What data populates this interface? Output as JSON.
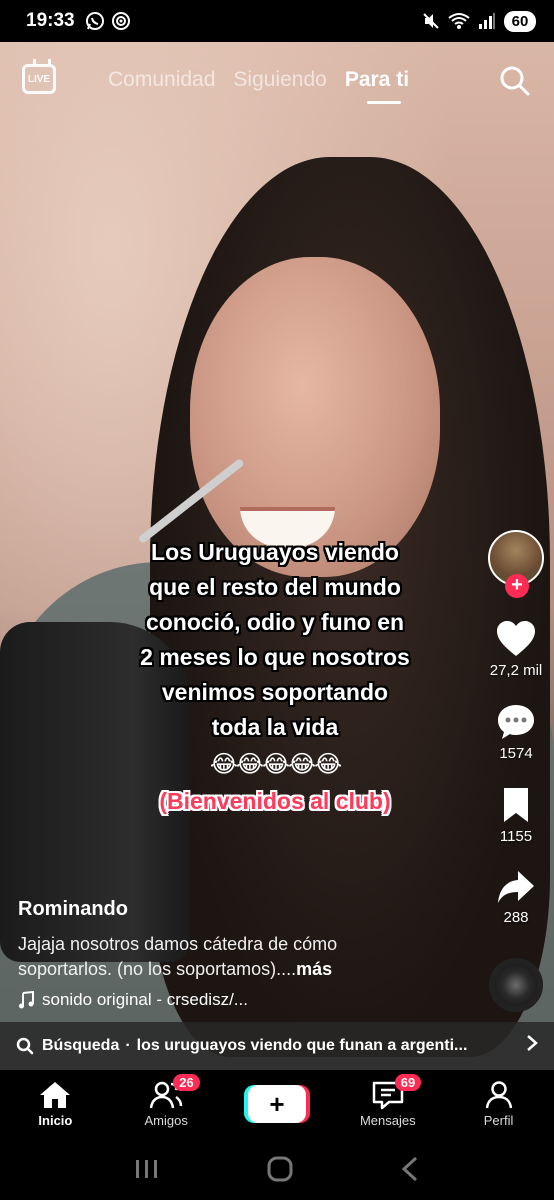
{
  "status_bar": {
    "time": "19:33",
    "left_icons": [
      "whatsapp-icon",
      "hotspot-icon"
    ],
    "right_icons": [
      "mute-icon",
      "wifi-icon",
      "signal-icon"
    ],
    "battery": "60"
  },
  "top_nav": {
    "live_label": "LIVE",
    "tabs": [
      {
        "label": "Comunidad",
        "active": false
      },
      {
        "label": "Siguiendo",
        "active": false
      },
      {
        "label": "Para ti",
        "active": true
      }
    ]
  },
  "overlay": {
    "lines": [
      "Los Uruguayos viendo",
      "que el resto del mundo",
      "conoció, odio y funo en",
      "2 meses lo que nosotros",
      "venimos soportando",
      "toda la vida"
    ],
    "emoji": "😂😂😂😂😂",
    "subtitle": "(Bienvenidos al club)"
  },
  "rail": {
    "likes": "27,2 mil",
    "comments": "1574",
    "saves": "1155",
    "shares": "288"
  },
  "post": {
    "author": "Rominando",
    "description": "Jajaja nosotros damos cátedra de cómo soportarlos. (no los soportamos)....",
    "more": "más",
    "sound": "sonido original - crsedisz/..."
  },
  "search_suggestion": {
    "label": "Búsqueda",
    "separator": "·",
    "query": "los uruguayos viendo que funan a argenti..."
  },
  "bottom_nav": {
    "items": [
      {
        "label": "Inicio",
        "active": true
      },
      {
        "label": "Amigos",
        "badge": "26"
      },
      {
        "label": "",
        "create": true
      },
      {
        "label": "Mensajes",
        "badge": "69"
      },
      {
        "label": "Perfil"
      }
    ]
  },
  "colors": {
    "accent": "#fe2c55",
    "cyan": "#25f4ee"
  }
}
